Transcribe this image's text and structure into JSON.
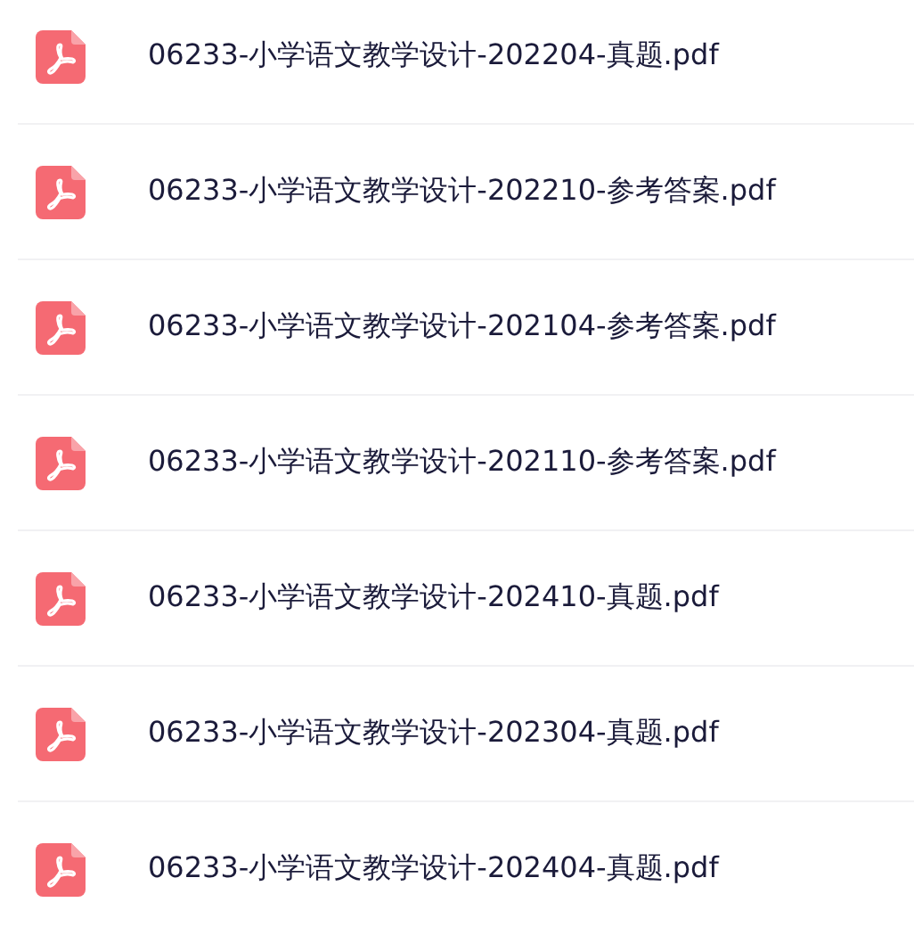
{
  "files": [
    {
      "name": "06233-小学语文教学设计-202204-真题.pdf"
    },
    {
      "name": "06233-小学语文教学设计-202210-参考答案.pdf"
    },
    {
      "name": "06233-小学语文教学设计-202104-参考答案.pdf"
    },
    {
      "name": "06233-小学语文教学设计-202110-参考答案.pdf"
    },
    {
      "name": "06233-小学语文教学设计-202410-真题.pdf"
    },
    {
      "name": "06233-小学语文教学设计-202304-真题.pdf"
    },
    {
      "name": "06233-小学语文教学设计-202404-真题.pdf"
    }
  ]
}
